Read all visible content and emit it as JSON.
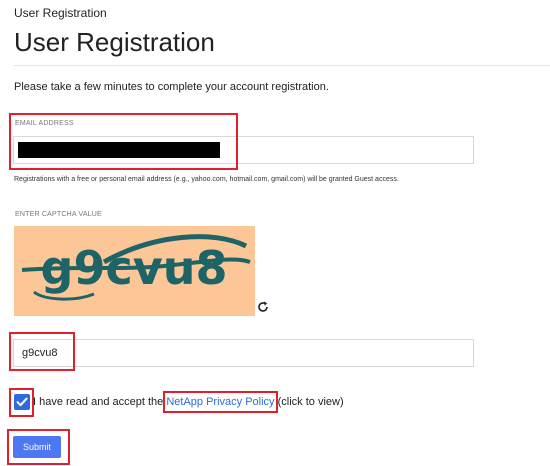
{
  "breadcrumb": "User Registration",
  "page_title": "User Registration",
  "intro_text": "Please take a few minutes to complete your account registration.",
  "email": {
    "label": "EMAIL ADDRESS",
    "value": "",
    "redacted": true,
    "help_text": "Registrations with a free or personal email address (e.g., yahoo.com, hotmail.com, gmail.com) will be granted Guest access."
  },
  "captcha": {
    "label": "ENTER CAPTCHA VALUE",
    "image_text": "g9cvu8",
    "value": "g9cvu8",
    "refresh_icon": "refresh-icon"
  },
  "terms": {
    "checked": true,
    "text_before": "I have read and accept the",
    "link_text": "NetApp Privacy Policy",
    "text_after": "(click to view)"
  },
  "submit_label": "Submit",
  "colors": {
    "accent": "#4e77f2",
    "link": "#2c6bd9",
    "highlight": "#e0202c",
    "captcha_bg": "#fdc697",
    "captcha_text": "#1e6466"
  }
}
